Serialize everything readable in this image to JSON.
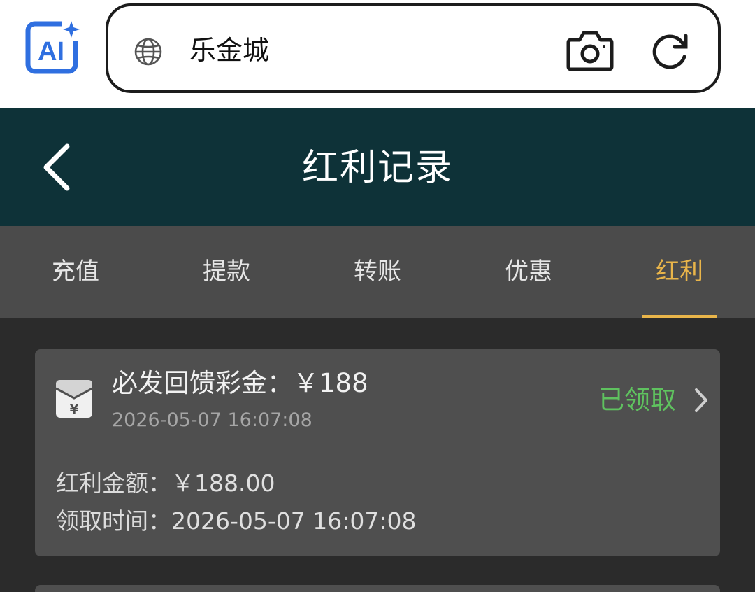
{
  "browser": {
    "logo_text": "AI",
    "url_text": "乐金城"
  },
  "header": {
    "title": "红利记录"
  },
  "tabs": [
    {
      "label": "充值",
      "active": false
    },
    {
      "label": "提款",
      "active": false
    },
    {
      "label": "转账",
      "active": false
    },
    {
      "label": "优惠",
      "active": false
    },
    {
      "label": "红利",
      "active": true
    }
  ],
  "records": [
    {
      "title": "必发回馈彩金：￥188",
      "time": "2026-05-07 16:07:08",
      "status": "已领取",
      "amount_label": "红利金额：",
      "amount_value": "￥188.00",
      "claim_label": "领取时间：",
      "claim_value": "2026-05-07 16:07:08"
    }
  ],
  "colors": {
    "header_bg": "#0e3238",
    "tab_active": "#e9b54a",
    "status_claimed": "#5fc25f",
    "logo_blue": "#2f6fe0"
  }
}
